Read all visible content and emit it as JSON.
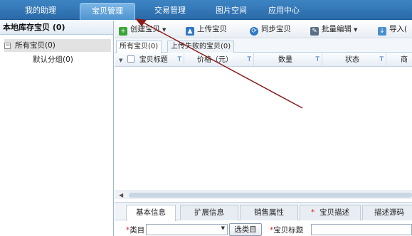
{
  "top_nav": {
    "tabs": [
      {
        "label": "我的助理"
      },
      {
        "label": "宝贝管理"
      },
      {
        "label": "交易管理"
      },
      {
        "label": "图片空间"
      },
      {
        "label": "应用中心"
      }
    ]
  },
  "sidebar": {
    "title": "本地库存宝贝 (0)",
    "tree": {
      "toggle": "−",
      "root_label": "所有宝贝(0)",
      "child_label": "默认分组(0)"
    }
  },
  "toolbar": {
    "create_label": "创建宝贝",
    "upload_label": "上传宝贝",
    "sync_label": "同步宝贝",
    "batch_edit_label": "批量编辑",
    "import_label": "导入("
  },
  "subtabs": {
    "all_label": "所有宝贝(0)",
    "failed_label": "上传失败的宝贝(0)"
  },
  "columns": {
    "title": "宝贝标题",
    "price": "价格（元）",
    "quantity": "数量",
    "status": "状态",
    "cut": "商"
  },
  "detail_tabs": {
    "basic": "基本信息",
    "extended": "扩展信息",
    "sales_attr": "销售属性",
    "description": "宝贝描述",
    "desc_source": "描述源码"
  },
  "form": {
    "category_label": "类目",
    "choose_category_button": "选类目",
    "title_label": "宝贝标题",
    "required_mark": "*"
  },
  "colors": {
    "nav_blue": "#2b6aa8",
    "annotation_red": "#8b1a1a"
  }
}
